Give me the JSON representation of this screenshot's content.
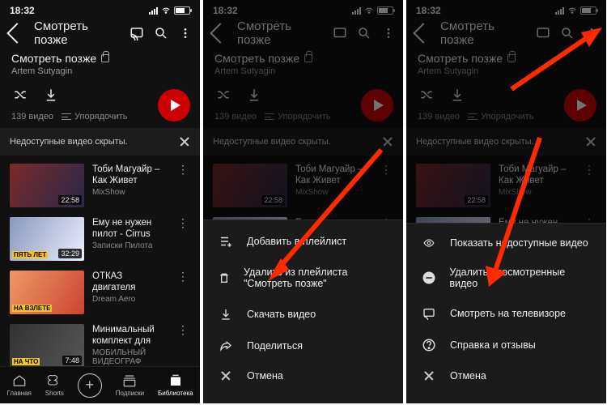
{
  "status": {
    "time": "18:32"
  },
  "header": {
    "title": "Смотреть позже"
  },
  "playlist": {
    "title": "Смотреть позже",
    "author": "Artem Sutyagin"
  },
  "info": {
    "count": "139 видео",
    "sort": "Упорядочить"
  },
  "notice": {
    "text": "Недоступные видео скрыты."
  },
  "videos": [
    {
      "title": "Тоби Магуайр – Как Живет Человек-Па...",
      "channel": "MixShow",
      "duration": "22:58"
    },
    {
      "title": "Ему не нужен пилот - Cirrus Vision Jet",
      "channel": "Записки Пилота",
      "duration": "32:29"
    },
    {
      "title": "ОТКАЗ двигателя самолета НА ВЗЛЕТ...",
      "channel": "Dream Aero",
      "duration": ""
    },
    {
      "title": "Минимальный комплект для съем...",
      "channel": "МОБИЛЬНЫЙ ВИДЕОГРАФ",
      "duration": "7:48"
    }
  ],
  "thumb_badges": [
    "",
    "ПЯТЬ ЛЕТ",
    "НА ВЗЛЕТЕ",
    "НА ЧТО"
  ],
  "tabs": {
    "home": "Главная",
    "shorts": "Shorts",
    "subs": "Подписки",
    "lib": "Библиотека"
  },
  "sheet_video": {
    "i1": "Добавить в плейлист",
    "i2": "Удалить из плейлиста \"Смотреть позже\"",
    "i3": "Скачать видео",
    "i4": "Поделиться",
    "cancel": "Отмена"
  },
  "sheet_more": {
    "i1": "Показать недоступные видео",
    "i2": "Удалить просмотренные видео",
    "i3": "Смотреть на телевизоре",
    "i4": "Справка и отзывы",
    "cancel": "Отмена"
  }
}
